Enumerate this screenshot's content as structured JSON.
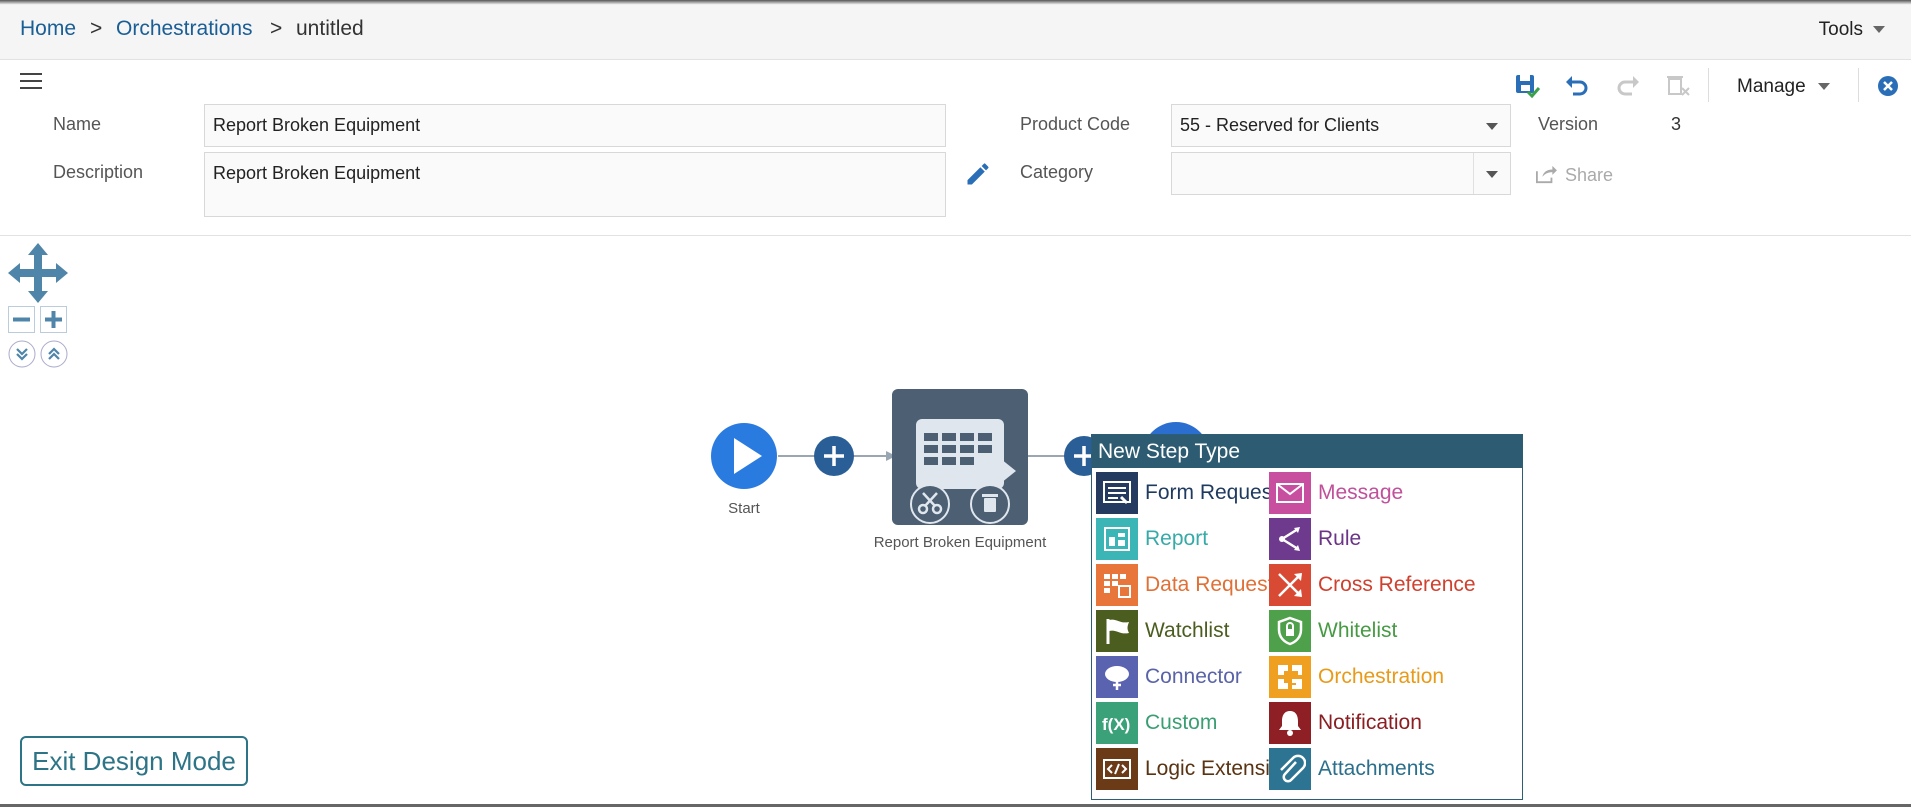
{
  "breadcrumb": {
    "home": "Home",
    "sep1": ">",
    "orchestrations": "Orchestrations",
    "sep2": ">",
    "current": "untitled"
  },
  "tools": {
    "label": "Tools"
  },
  "form": {
    "name_label": "Name",
    "name_value": "Report Broken Equipment",
    "description_label": "Description",
    "description_value": "Report Broken Equipment",
    "product_code_label": "Product Code",
    "product_code_value": "55 - Reserved for Clients",
    "category_label": "Category",
    "category_value": "",
    "version_label": "Version",
    "version_value": "3",
    "share_label": "Share"
  },
  "toolbar": {
    "manage_label": "Manage",
    "icons": [
      "save-icon",
      "undo-icon",
      "redo-icon",
      "delete-icon",
      "close-icon"
    ]
  },
  "canvas": {
    "start_label": "Start",
    "step_label": "Report Broken Equipment"
  },
  "exit_button": {
    "label": "Exit Design Mode"
  },
  "popup": {
    "title": "New Step Type",
    "left": [
      {
        "label": "Form Request",
        "icon": "form-request-icon",
        "color": "#243a5e",
        "textColor": "#1f3a5f"
      },
      {
        "label": "Report",
        "icon": "report-icon",
        "color": "#3bb5b5",
        "textColor": "#36aaa8"
      },
      {
        "label": "Data Request",
        "icon": "data-request-icon",
        "color": "#e8763a",
        "textColor": "#e07035"
      },
      {
        "label": "Watchlist",
        "icon": "watchlist-icon",
        "color": "#4b5d1f",
        "textColor": "#4b5d1f"
      },
      {
        "label": "Connector",
        "icon": "connector-icon",
        "color": "#5a63b0",
        "textColor": "#5a63a8"
      },
      {
        "label": "Custom",
        "icon": "custom-icon",
        "color": "#3aa178",
        "textColor": "#3a9e73"
      },
      {
        "label": "Logic Extension",
        "icon": "logic-extension-icon",
        "color": "#6b3a17",
        "textColor": "#5a3312"
      }
    ],
    "right": [
      {
        "label": "Message",
        "icon": "message-icon",
        "color": "#c84fa0",
        "textColor": "#c0509a"
      },
      {
        "label": "Rule",
        "icon": "rule-icon",
        "color": "#6e3a8e",
        "textColor": "#6a3487"
      },
      {
        "label": "Cross Reference",
        "icon": "cross-reference-icon",
        "color": "#d94a35",
        "textColor": "#d0402e"
      },
      {
        "label": "Whitelist",
        "icon": "whitelist-icon",
        "color": "#4fa04a",
        "textColor": "#479a44"
      },
      {
        "label": "Orchestration",
        "icon": "orchestration-icon",
        "color": "#f0a020",
        "textColor": "#e89a1a"
      },
      {
        "label": "Notification",
        "icon": "notification-icon",
        "color": "#8e1f24",
        "textColor": "#8a1e22"
      },
      {
        "label": "Attachments",
        "icon": "attachments-icon",
        "color": "#2d7492",
        "textColor": "#2b6f8c"
      }
    ]
  }
}
